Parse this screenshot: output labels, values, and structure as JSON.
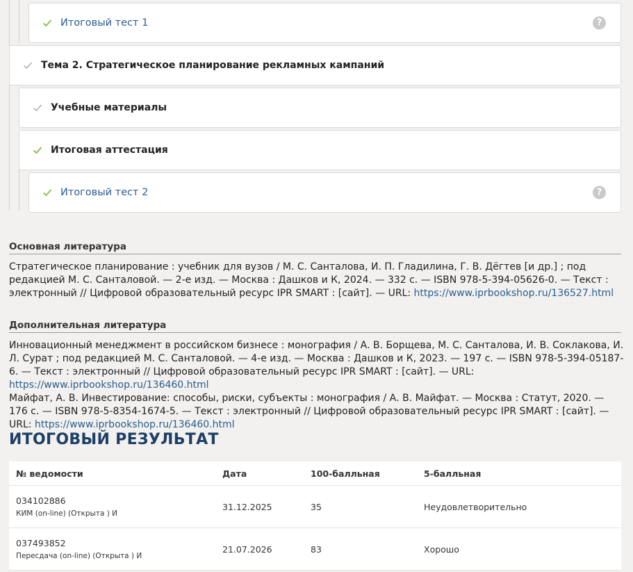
{
  "tree": {
    "items": [
      {
        "label": "Итоговый тест 1",
        "check_color": "#8bc34a",
        "help": "?"
      },
      {
        "label": "Тема 2. Стратегическое планирование рекламных кампаний",
        "check_color": "#9e9e9e"
      },
      {
        "label": "Учебные материалы",
        "check_color": "#9e9e9e"
      },
      {
        "label": "Итоговая аттестация",
        "check_color": "#8bc34a"
      },
      {
        "label": "Итоговый тест 2",
        "check_color": "#8bc34a",
        "help": "?"
      }
    ]
  },
  "literature": {
    "main_title": "Основная литература",
    "main_text": "Стратегическое планирование : учебник для вузов / М. С. Санталова, И. П. Гладилина, Г. В. Дёгтев [и др.] ; под редакцией М. С. Санталовой. — 2-е изд. — Москва : Дашков и К, 2024. — 332 с. — ISBN 978-5-394-05626-0. — Текст : электронный // Цифровой образовательный ресурс IPR SMART : [сайт]. — URL: ",
    "main_link": "https://www.iprbookshop.ru/136527.html",
    "extra_title": "Дополнительная литература",
    "extra_text_1": "Инновационный менеджмент в российском бизнесе : монография / А. В. Борщева, М. С. Санталова, И. В. Соклакова, И. Л. Сурат ; под редакцией М. С. Санталовой. — 4-е изд. — Москва : Дашков и К, 2023. — 197 с. — ISBN 978-5-394-05187-6. — Текст : электронный // Цифровой образовательный ресурс IPR SMART : [сайт]. — URL: ",
    "extra_link_1": "https://www.iprbookshop.ru/136460.html",
    "extra_text_2": "Майфат, А. В. Инвестирование: способы, риски, субъекты : монография / А. В. Майфат. — Москва : Статут, 2020. — 176 с. — ISBN 978-5-8354-1674-5. — Текст : электронный // Цифровой образовательный ресурс IPR SMART : [сайт]. — URL: ",
    "extra_link_2": "https://www.iprbookshop.ru/136460.html"
  },
  "result": {
    "title": "ИТОГОВЫЙ РЕЗУЛЬТАТ",
    "headers": [
      "№ ведомости",
      "Дата",
      "100-балльная",
      "5-балльная"
    ],
    "rows": [
      {
        "number": "034102886",
        "desc": "КИМ (on-line) (Открыта ) И",
        "date": "31.12.2025",
        "score100": "35",
        "score5": "Неудовлетворительно"
      },
      {
        "number": "037493852",
        "desc": "Пересдача (on-line) (Открыта ) И",
        "date": "21.07.2026",
        "score100": "83",
        "score5": "Хорошо"
      }
    ]
  }
}
